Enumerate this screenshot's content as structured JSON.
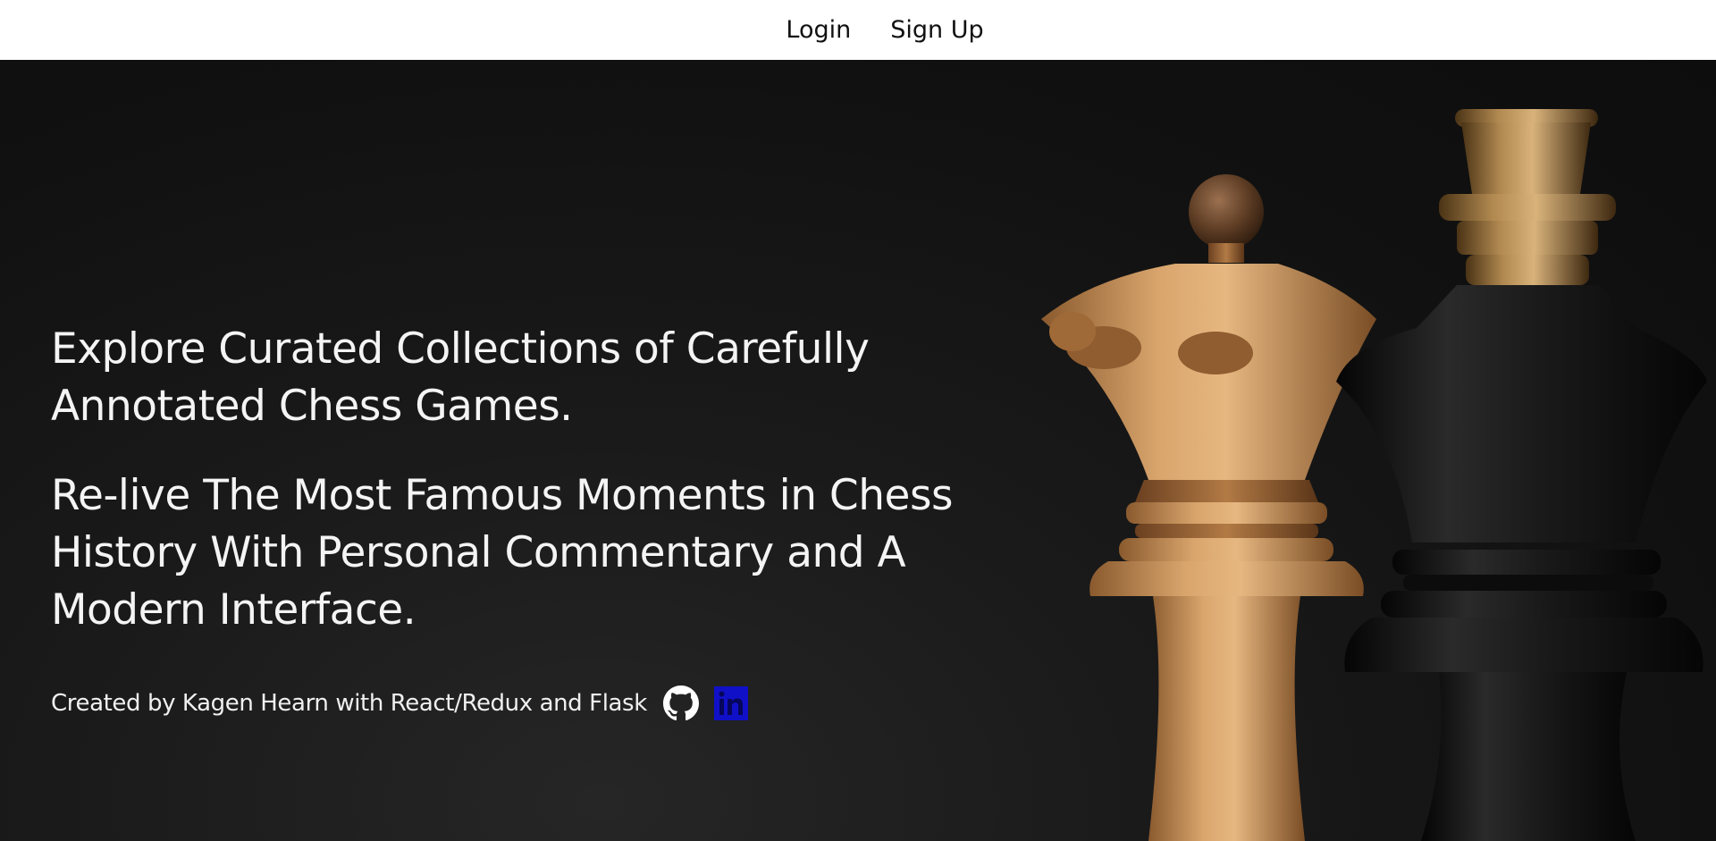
{
  "nav": {
    "login_label": "Login",
    "signup_label": "Sign Up"
  },
  "hero": {
    "headline_1": "Explore Curated Collections of Carefully Annotated Chess Games.",
    "headline_2": "Re-live The Most Famous Moments in Chess History With Personal Commentary and A Modern Interface.",
    "credit": "Created by Kagen Hearn with React/Redux and Flask",
    "icons": {
      "github": "github-icon",
      "linkedin": "linkedin-icon"
    },
    "image_semantic": "chess-queen-and-king-image"
  },
  "colors": {
    "nav_background": "#ffffff",
    "hero_background": "#141414",
    "text_light": "#f4f4f4",
    "linkedin_blue": "#1010c8"
  }
}
